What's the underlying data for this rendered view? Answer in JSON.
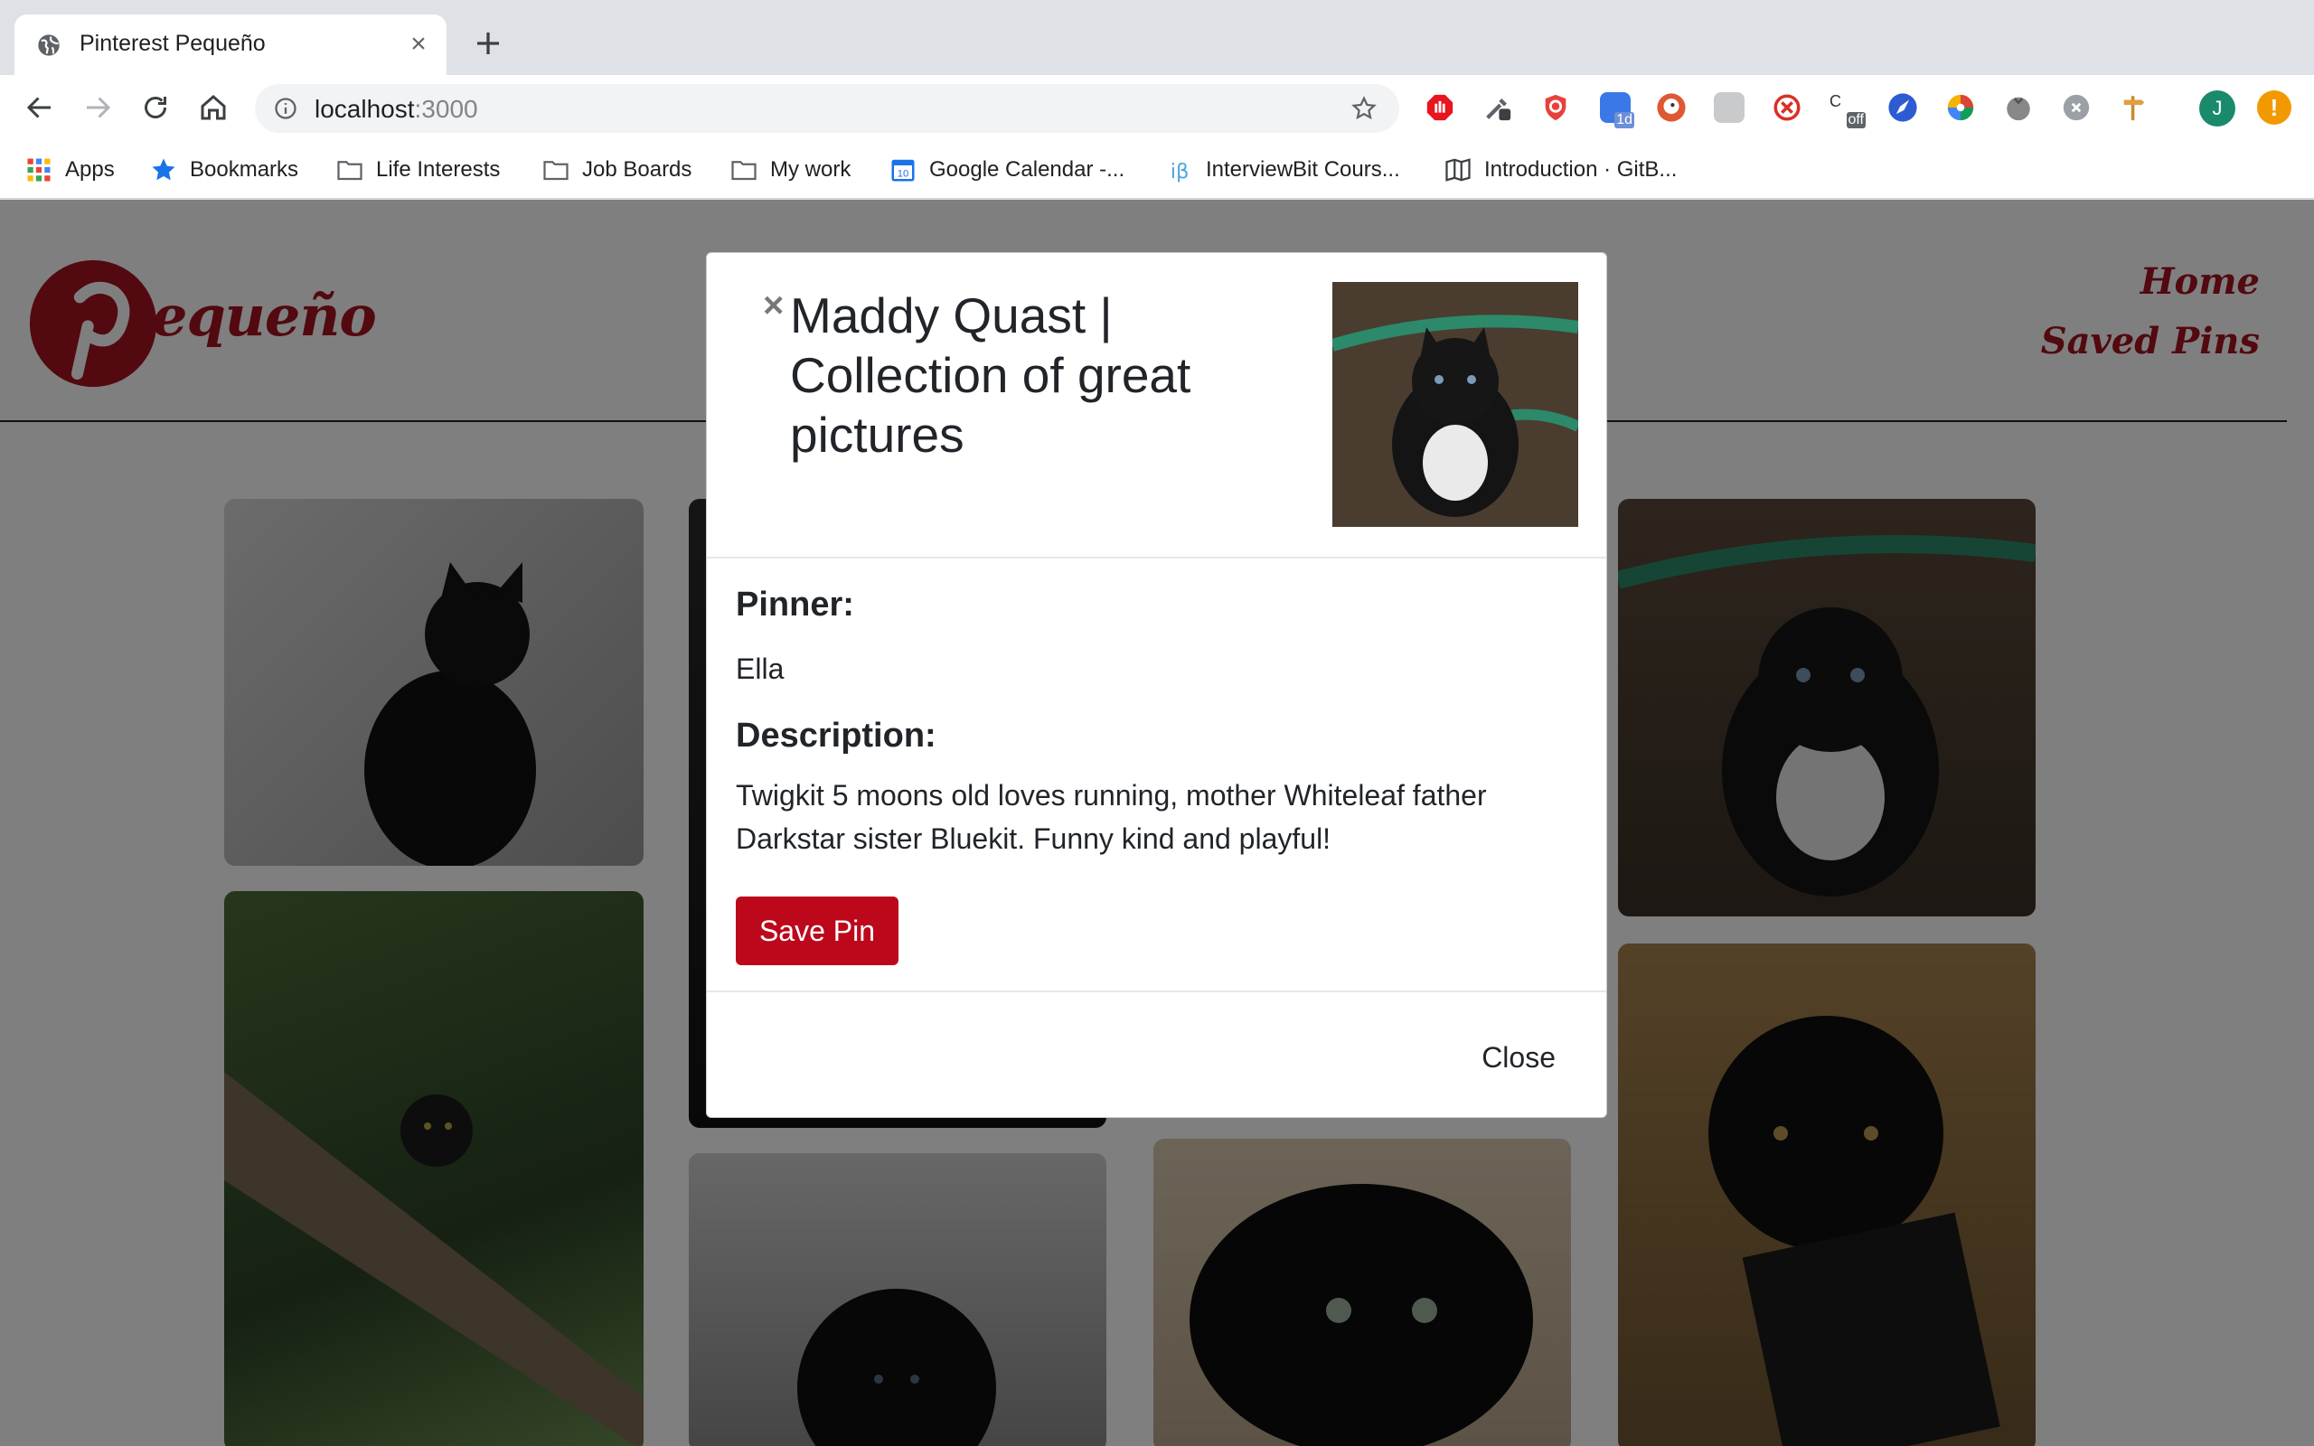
{
  "browser": {
    "tab": {
      "title": "Pinterest Pequeño",
      "favicon": "globe-icon"
    },
    "url": {
      "host": "localhost",
      "port": ":3000"
    },
    "bookmarks": [
      {
        "label": "Apps",
        "icon": "apps-grid-icon"
      },
      {
        "label": "Bookmarks",
        "icon": "star-icon"
      },
      {
        "label": "Life Interests",
        "icon": "folder-icon"
      },
      {
        "label": "Job Boards",
        "icon": "folder-icon"
      },
      {
        "label": "My work",
        "icon": "folder-icon"
      },
      {
        "label": "Google Calendar -...",
        "icon": "calendar-icon"
      },
      {
        "label": "InterviewBit Cours...",
        "icon": "interviewbit-icon"
      },
      {
        "label": "Introduction · GitB...",
        "icon": "book-icon"
      }
    ],
    "extension_badges": {
      "badge_1d": "1d",
      "badge_off": "off"
    },
    "profile_initial": "J",
    "alert_glyph": "!"
  },
  "site": {
    "brand": "equeño",
    "nav": {
      "home": "Home",
      "saved": "Saved Pins"
    },
    "accent_color": "#a4131e"
  },
  "modal": {
    "close_glyph": "×",
    "title": "Maddy Quast | Collection of great pictures",
    "pinner_label": "Pinner:",
    "pinner": "Ella",
    "description_label": "Description:",
    "description": "Twigkit 5 moons old loves running, mother Whiteleaf father Darkstar sister Bluekit. Funny kind and playful!",
    "save_button": "Save Pin",
    "close_button": "Close",
    "button_color": "#bd081c"
  }
}
